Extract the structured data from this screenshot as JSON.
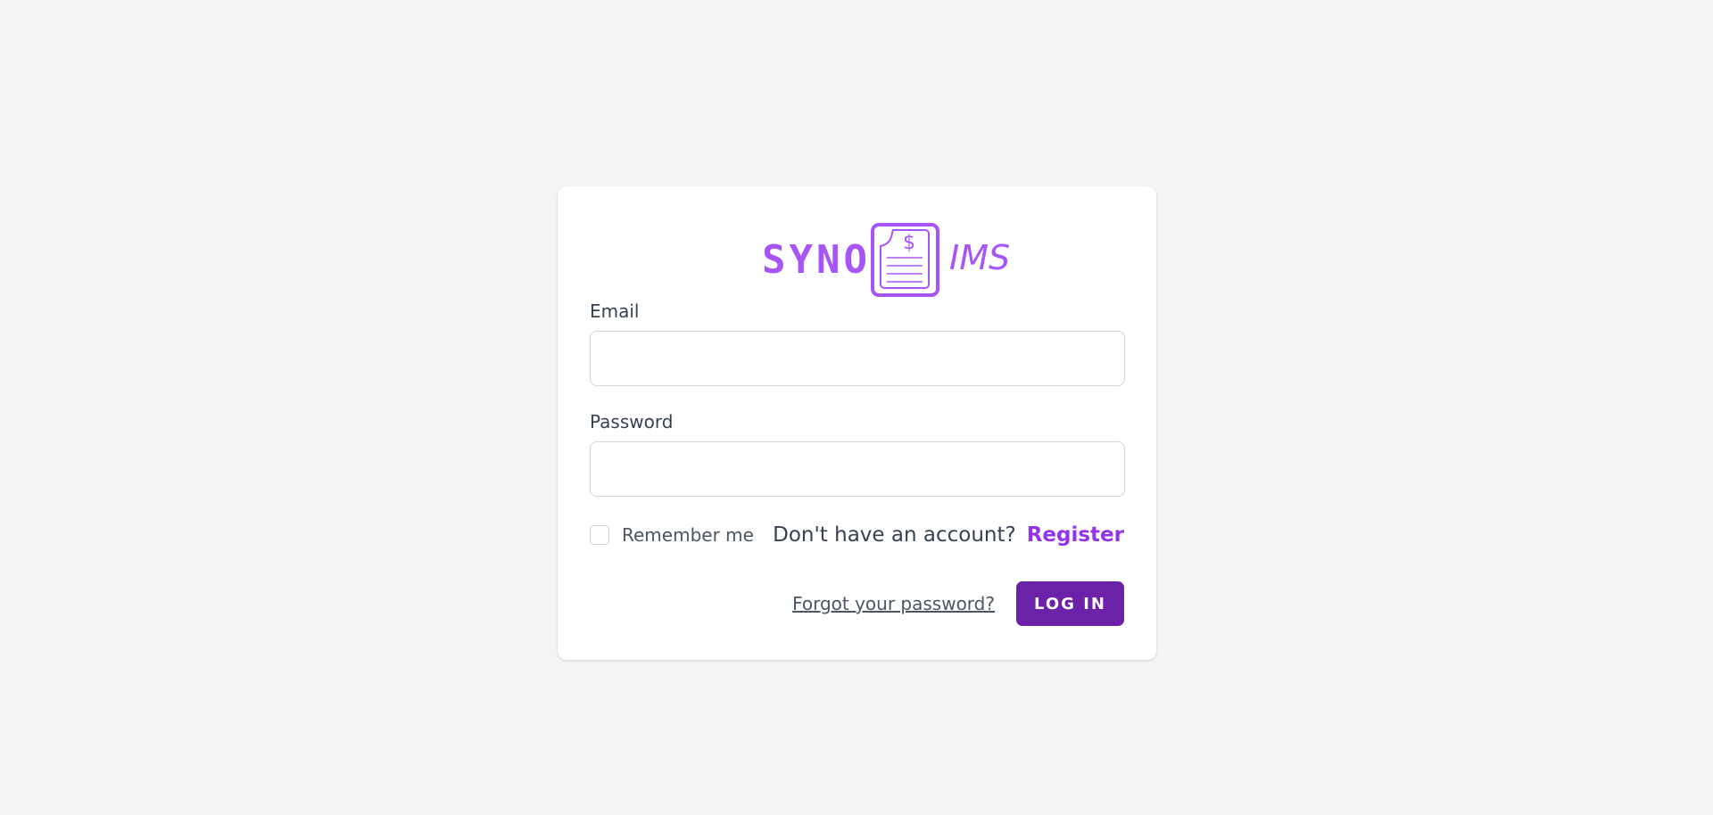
{
  "logo": {
    "left_text": "SYNO",
    "right_text": "IMS",
    "doc_symbol": "$",
    "brand_color": "#a855f7",
    "icon": "invoice-document-icon"
  },
  "form": {
    "email_label": "Email",
    "email_value": "",
    "password_label": "Password",
    "password_value": "",
    "remember_label": "Remember me",
    "remember_checked": false
  },
  "register": {
    "prompt": "Don't have an account?",
    "link_label": "Register",
    "link_color": "#9333ea"
  },
  "actions": {
    "forgot_label": "Forgot your password?",
    "login_label": "LOG IN",
    "login_color": "#6b21a8"
  },
  "colors": {
    "background": "#f3f4f6",
    "card": "#ffffff"
  }
}
